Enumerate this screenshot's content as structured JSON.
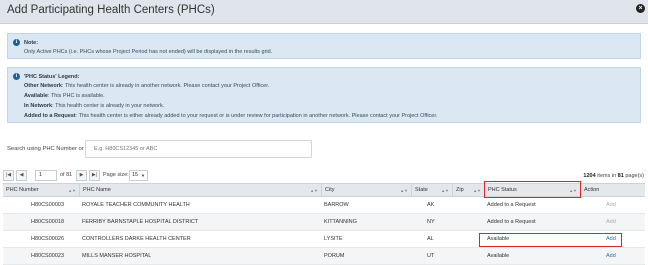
{
  "dialog": {
    "title": "Add Participating Health Centers (PHCs)"
  },
  "note": {
    "label": "Note:",
    "text": "Only Active PHCs (i.e. PHCs whose Project Period has not ended) will be displayed in the results grid."
  },
  "legend": {
    "title": "'PHC Status' Legend:",
    "items": [
      {
        "term": "Other Network",
        "text": ": This health center is already in another network. Please contact your Project Officer."
      },
      {
        "term": "Available",
        "text": ": This PHC is available."
      },
      {
        "term": "In Network",
        "text": ": This health center is already in your network."
      },
      {
        "term": "Added to a Request",
        "text": ": This health center is either already added to your request or is under review for participation in another network. Please contact your Project Officer."
      }
    ]
  },
  "search": {
    "label": "Search using PHC Number or Name",
    "placeholder": "E.g. H80CS12345 or ABC"
  },
  "pager": {
    "first": "|◀",
    "prev": "◀",
    "page": "1",
    "of_text": "of 81",
    "next": "▶",
    "last": "▶|",
    "page_size_label": "Page size:",
    "page_size": "15",
    "items_count": "1204",
    "items_text": " items in ",
    "pages_count": "81",
    "pages_text": " page(s)"
  },
  "table": {
    "columns": [
      "PHC Number",
      "PHC Name",
      "City",
      "State",
      "Zip",
      "PHC Status",
      "Action"
    ],
    "rows": [
      {
        "number": "H80CS00003",
        "name": "ROYALE TEACHER COMMUNITY HEALTH",
        "city": "BARROW",
        "state": "AK",
        "zip": "",
        "status": "Added to a Request",
        "action": "Add"
      },
      {
        "number": "H80CS00018",
        "name": "FERRIBY BARNSTAPLE HOSPITAL DISTRICT",
        "city": "KITTANNING",
        "state": "NY",
        "zip": "",
        "status": "Added to a Request",
        "action": "Add"
      },
      {
        "number": "H80CS00026",
        "name": "CONTROLLERS DARKE HEALTH CENTER",
        "city": "LYSITE",
        "state": "AL",
        "zip": "",
        "status": "Available",
        "action": "Add"
      },
      {
        "number": "H80CS00023",
        "name": "MILLS MANSER HOSPITAL",
        "city": "PORUM",
        "state": "UT",
        "zip": "",
        "status": "Available",
        "action": "Add"
      }
    ]
  },
  "colors": {
    "highlight": "#d9262b",
    "header_bg": "#e4e8ec",
    "info_bg": "#dbe8f4",
    "link": "#2a6db0"
  }
}
